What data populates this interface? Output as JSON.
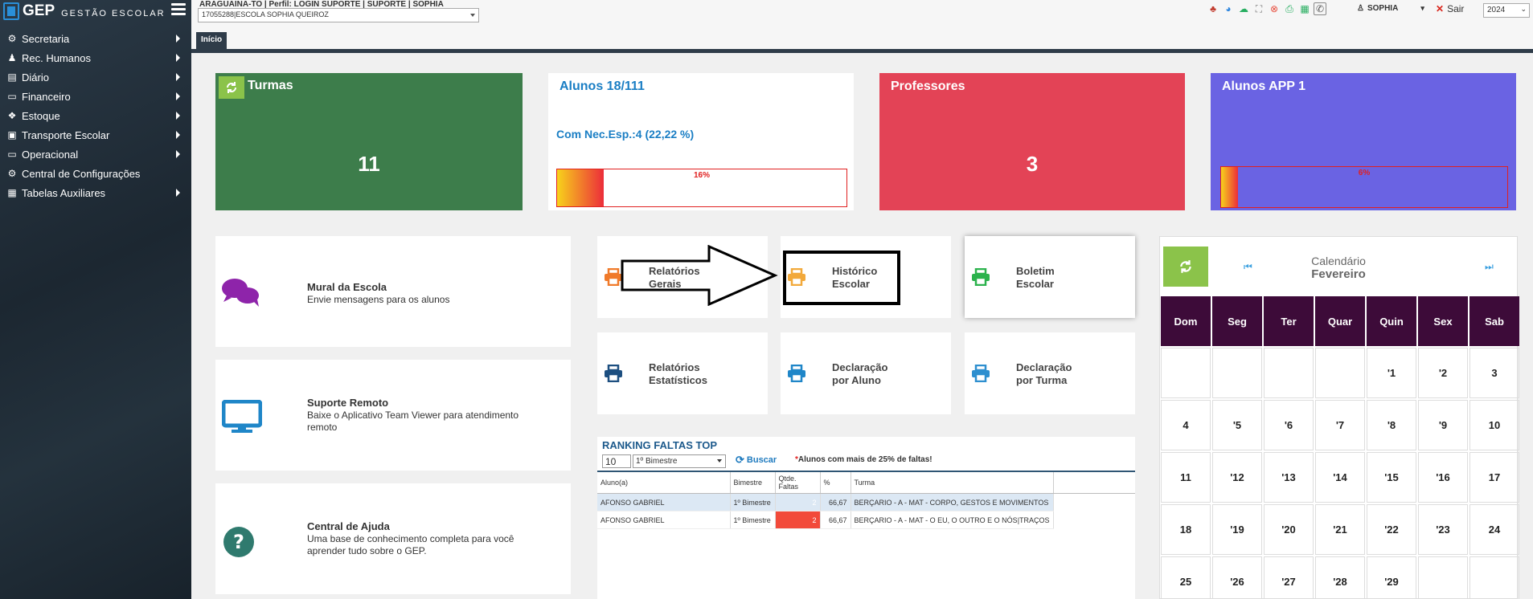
{
  "brand": {
    "name": "GEP",
    "subtitle": "GESTÃO ESCOLAR"
  },
  "sidebar": {
    "items": [
      {
        "label": "Secretaria",
        "icon": "gears-icon",
        "glyph": "⚙"
      },
      {
        "label": "Rec. Humanos",
        "icon": "person-icon",
        "glyph": "♟"
      },
      {
        "label": "Diário",
        "icon": "book-icon",
        "glyph": "▤"
      },
      {
        "label": "Financeiro",
        "icon": "money-icon",
        "glyph": "▭"
      },
      {
        "label": "Estoque",
        "icon": "boxes-icon",
        "glyph": "❖"
      },
      {
        "label": "Transporte Escolar",
        "icon": "bus-icon",
        "glyph": "▣"
      },
      {
        "label": "Operacional",
        "icon": "monitor-icon",
        "glyph": "▭"
      },
      {
        "label": "Central de Configurações",
        "icon": "gear-icon",
        "glyph": "⚙"
      },
      {
        "label": "Tabelas Auxiliares",
        "icon": "table-icon",
        "glyph": "▦"
      }
    ]
  },
  "topbar": {
    "context": "ARAGUAINA-TO | Perfil: LOGIN SUPORTE | SUPORTE | SOPHIA",
    "school": "17055288|ESCOLA SOPHIA QUEIROZ",
    "user": "SOPHIA",
    "logout": "Sair",
    "year": "2024"
  },
  "tabs": {
    "home": "Início"
  },
  "cards": {
    "turmas": {
      "title": "Turmas",
      "value": "11"
    },
    "alunos": {
      "title": "Alunos 18/111",
      "nec": "Com Nec.Esp.:4 (22,22 %)",
      "progress_text": "16%",
      "progress": 16
    },
    "professores": {
      "title": "Professores",
      "value": "3"
    },
    "app": {
      "title": "Alunos APP 1",
      "progress_text": "6%",
      "progress": 6
    }
  },
  "panels": {
    "mural": {
      "title": "Mural da Escola",
      "desc": "Envie mensagens para os alunos"
    },
    "suporte": {
      "title": "Suporte Remoto",
      "desc": "Baixe o Aplicativo Team Viewer para atendimento remoto"
    },
    "ajuda": {
      "title": "Central de Ajuda",
      "desc": "Uma base de conhecimento completa para você aprender tudo sobre o GEP."
    }
  },
  "tiles": {
    "rel_gerais": {
      "line1": "Relatórios",
      "line2": "Gerais",
      "color": "#f07a2a"
    },
    "historico": {
      "line1": "Histórico",
      "line2": "Escolar",
      "color": "#f2a93b"
    },
    "boletim": {
      "line1": "Boletim",
      "line2": "Escolar",
      "color": "#2bb24c"
    },
    "rel_est": {
      "line1": "Relatórios",
      "line2": "Estatísticos",
      "color": "#1d4f80"
    },
    "decl_aluno": {
      "line1": "Declaração",
      "line2": "por Aluno",
      "color": "#1f86c8"
    },
    "decl_turma": {
      "line1": "Declaração",
      "line2": "por Turma",
      "color": "#2e8fcf"
    }
  },
  "ranking": {
    "title": "RANKING FALTAS TOP",
    "top": "10",
    "bimestre": "1º Bimestre",
    "search": "Buscar",
    "note": "Alunos com mais de 25% de faltas!",
    "columns": [
      "Aluno(a)",
      "Bimestre",
      "Qtde. Faltas",
      "%",
      "Turma"
    ],
    "rows": [
      [
        "AFONSO GABRIEL",
        "1º Bimestre",
        "2",
        "66,67",
        "BERÇARIO - A - MAT - CORPO, GESTOS E MOVIMENTOS"
      ],
      [
        "AFONSO GABRIEL",
        "1º Bimestre",
        "2",
        "66,67",
        "BERÇARIO - A - MAT - O EU, O OUTRO E O NÓS|TRAÇOS"
      ]
    ]
  },
  "calendar": {
    "title": "Calendário",
    "month": "Fevereiro",
    "weekdays": [
      "Dom",
      "Seg",
      "Ter",
      "Quar",
      "Quin",
      "Sex",
      "Sab"
    ],
    "days": [
      "",
      "",
      "",
      "",
      "'1",
      "'2",
      "3",
      "4",
      "'5",
      "'6",
      "'7",
      "'8",
      "'9",
      "10",
      "11",
      "'12",
      "'13",
      "'14",
      "'15",
      "'16",
      "17",
      "18",
      "'19",
      "'20",
      "'21",
      "'22",
      "'23",
      "24",
      "25",
      "'26",
      "'27",
      "'28",
      "'29",
      "",
      ""
    ]
  },
  "colors": {
    "sidebar": "#1c2731",
    "turmas": "#3d7d4b",
    "professores": "#e34356",
    "app": "#6a63e3",
    "calendar_head": "#3d0b39"
  }
}
